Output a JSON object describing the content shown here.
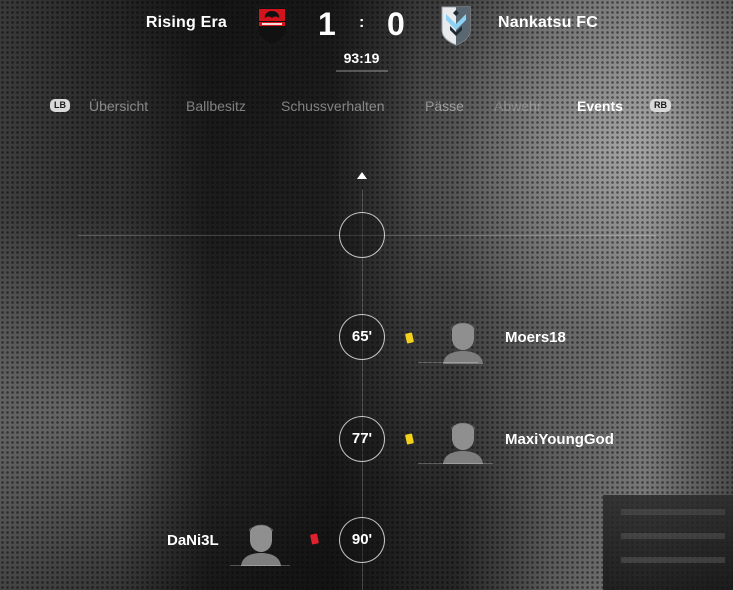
{
  "match": {
    "home": {
      "name": "Rising Era",
      "score": "1",
      "crest_icon": "stade-rennais-crest-icon",
      "crest_color": "#d2141c"
    },
    "away": {
      "name": "Nankatsu FC",
      "score": "0",
      "crest_icon": "minnesota-united-crest-icon",
      "crest_color": "#8cd2f4"
    },
    "separator": ":",
    "clock": "93:19"
  },
  "tabs": {
    "lb_label": "LB",
    "rb_label": "RB",
    "items": [
      {
        "label": "Übersicht",
        "state": "inactive"
      },
      {
        "label": "Ballbesitz",
        "state": "inactive"
      },
      {
        "label": "Schussverhalten",
        "state": "inactive"
      },
      {
        "label": "Pässe",
        "state": "inactive"
      },
      {
        "label": "Abwehr",
        "state": "disabled"
      },
      {
        "label": "Events",
        "state": "active"
      }
    ]
  },
  "timeline": {
    "scroll_up_icon": "arrow-up-icon",
    "events": [
      {
        "minute": "65'",
        "side": "away",
        "card": "yellow",
        "player": "Moers18"
      },
      {
        "minute": "77'",
        "side": "away",
        "card": "yellow",
        "player": "MaxiYoungGod"
      },
      {
        "minute": "90'",
        "side": "home",
        "card": "red",
        "player": "DaNi3L"
      }
    ]
  },
  "colors": {
    "yellow_card": "#f2d21c",
    "red_card": "#e3202e"
  }
}
